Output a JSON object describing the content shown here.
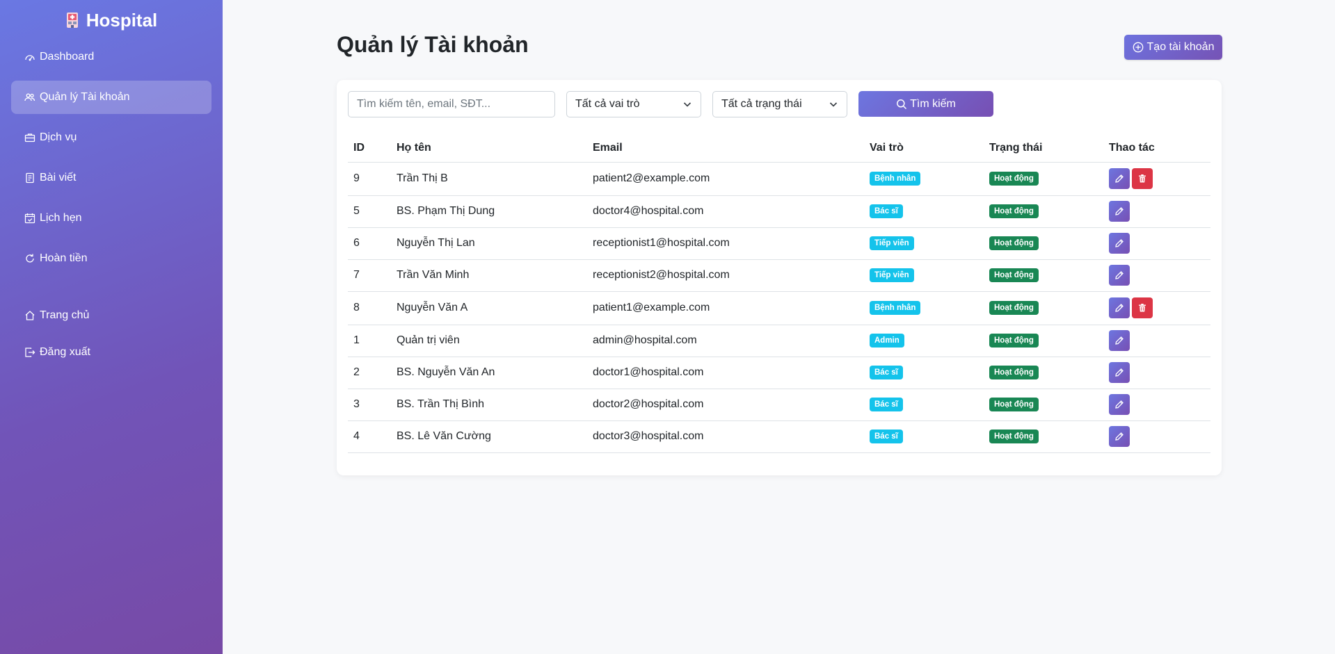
{
  "brand": {
    "name": "Hospital",
    "icon": "hospital-icon"
  },
  "sidebar": {
    "items": [
      {
        "label": "Dashboard",
        "icon": "speedometer-icon",
        "active": false
      },
      {
        "label": "Quản lý Tài khoản",
        "icon": "people-icon",
        "active": true
      },
      {
        "label": "Dịch vụ",
        "icon": "briefcase-icon",
        "active": false
      },
      {
        "label": "Bài viết",
        "icon": "document-icon",
        "active": false
      },
      {
        "label": "Lịch hẹn",
        "icon": "calendar-check-icon",
        "active": false
      },
      {
        "label": "Hoàn tiền",
        "icon": "refresh-icon",
        "active": false
      }
    ],
    "bottom_items": [
      {
        "label": "Trang chủ",
        "icon": "house-icon"
      },
      {
        "label": "Đăng xuất",
        "icon": "logout-icon"
      }
    ]
  },
  "header": {
    "title": "Quản lý Tài khoản",
    "create_button": "Tạo tài khoản"
  },
  "filters": {
    "search_placeholder": "Tìm kiếm tên, email, SĐT...",
    "role_select": "Tất cả vai trò",
    "status_select": "Tất cả trạng thái",
    "search_button": "Tìm kiếm"
  },
  "table": {
    "columns": [
      "ID",
      "Họ tên",
      "Email",
      "Vai trò",
      "Trạng thái",
      "Thao tác"
    ],
    "rows": [
      {
        "id": "9",
        "name": "Trần Thị B",
        "email": "patient2@example.com",
        "role": "Bệnh nhân",
        "status": "Hoạt động",
        "deletable": true
      },
      {
        "id": "5",
        "name": "BS. Phạm Thị Dung",
        "email": "doctor4@hospital.com",
        "role": "Bác sĩ",
        "status": "Hoạt động",
        "deletable": false
      },
      {
        "id": "6",
        "name": "Nguyễn Thị Lan",
        "email": "receptionist1@hospital.com",
        "role": "Tiếp viên",
        "status": "Hoạt động",
        "deletable": false
      },
      {
        "id": "7",
        "name": "Trần Văn Minh",
        "email": "receptionist2@hospital.com",
        "role": "Tiếp viên",
        "status": "Hoạt động",
        "deletable": false
      },
      {
        "id": "8",
        "name": "Nguyễn Văn A",
        "email": "patient1@example.com",
        "role": "Bệnh nhân",
        "status": "Hoạt động",
        "deletable": true
      },
      {
        "id": "1",
        "name": "Quản trị viên",
        "email": "admin@hospital.com",
        "role": "Admin",
        "status": "Hoạt động",
        "deletable": false
      },
      {
        "id": "2",
        "name": "BS. Nguyễn Văn An",
        "email": "doctor1@hospital.com",
        "role": "Bác sĩ",
        "status": "Hoạt động",
        "deletable": false
      },
      {
        "id": "3",
        "name": "BS. Trần Thị Bình",
        "email": "doctor2@hospital.com",
        "role": "Bác sĩ",
        "status": "Hoạt động",
        "deletable": false
      },
      {
        "id": "4",
        "name": "BS. Lê Văn Cường",
        "email": "doctor3@hospital.com",
        "role": "Bác sĩ",
        "status": "Hoạt động",
        "deletable": false
      }
    ]
  },
  "colors": {
    "sidebar_gradient_start": "#6a78e3",
    "sidebar_gradient_end": "#774aa6",
    "role_badge": "#14c3eb",
    "status_badge": "#198754",
    "delete_button": "#dc3545"
  }
}
